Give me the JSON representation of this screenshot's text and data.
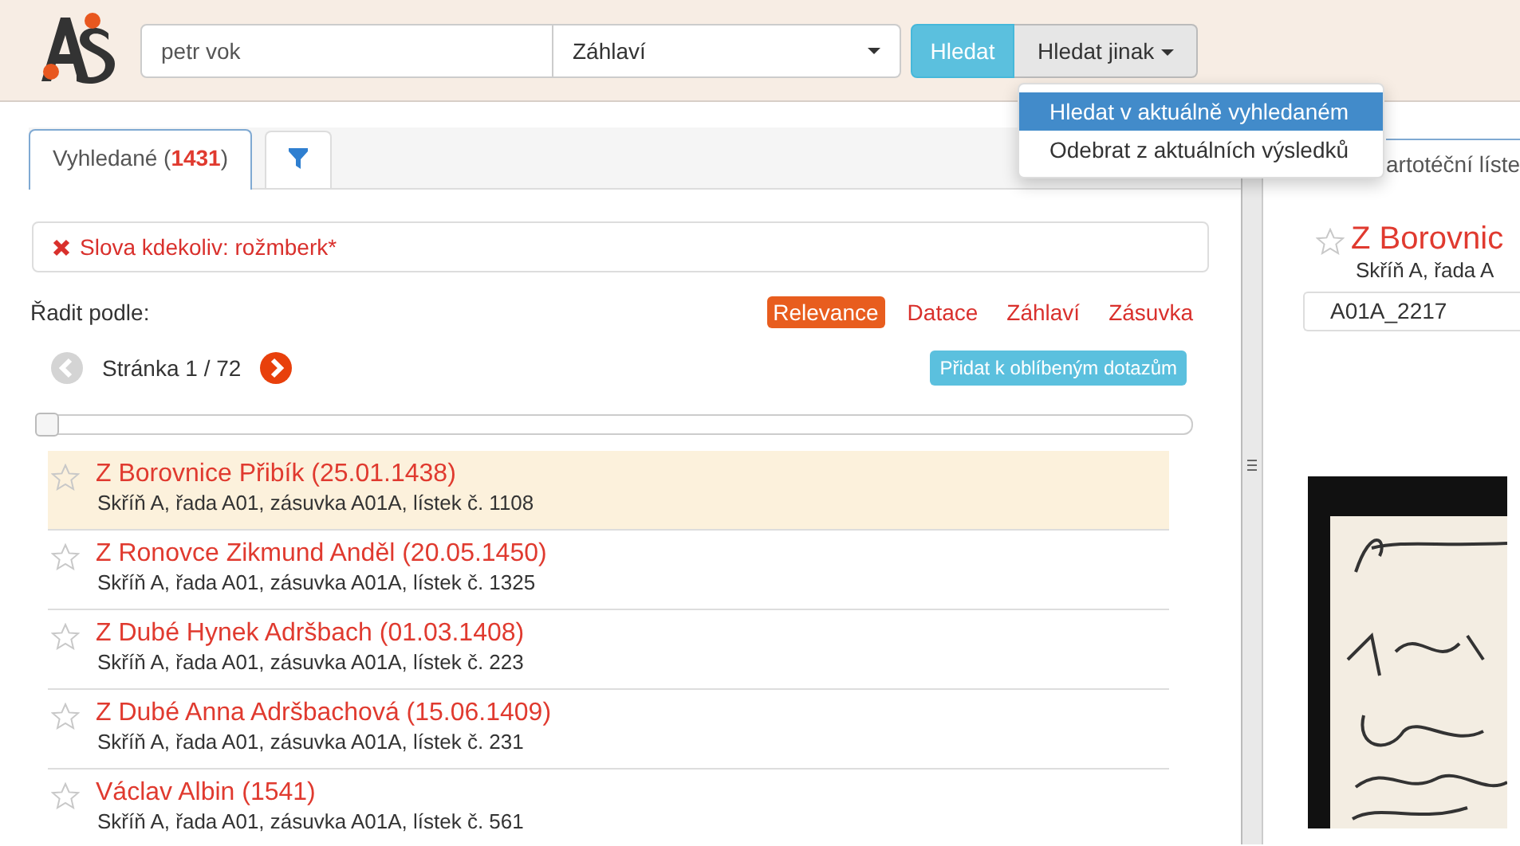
{
  "header": {
    "search": {
      "value": "petr vok"
    },
    "field_select": {
      "value": "Záhlaví"
    },
    "search_button": "Hledat",
    "more_button": "Hledat jinak",
    "menu": [
      {
        "label": "Hledat v aktuálně vyhledaném",
        "selected": true
      },
      {
        "label": "Odebrat z aktuálních výsledků",
        "selected": false
      }
    ]
  },
  "left": {
    "tabs": [
      {
        "kind": "text",
        "label": "Vyhledané (**1431**)",
        "selected": true
      },
      {
        "kind": "filter",
        "selected": false
      }
    ],
    "filter_chip": "Slova kdekoliv: rožmberk*",
    "sort_label": "Řadit podle:",
    "sort_options": [
      {
        "label": "Relevance",
        "selected": true
      },
      {
        "label": "Datace",
        "selected": false
      },
      {
        "label": "Záhlaví",
        "selected": false
      },
      {
        "label": "Zásuvka",
        "selected": false
      }
    ],
    "page": "Stránka 1 / 72",
    "favorite_button": "Přidat k oblíbeným dotazům",
    "slider": {
      "level": 0
    },
    "results": [
      {
        "title": "Z Borovnice Přibík (25.01.1438)",
        "location": "Skříň A, řada A01, zásuvka A01A, lístek č. 1108",
        "selected": true
      },
      {
        "title": "Z Ronovce Zikmund Anděl (20.05.1450)",
        "location": "Skříň A, řada A01, zásuvka A01A, lístek č. 1325",
        "selected": false
      },
      {
        "title": "Z Dubé Hynek Adršbach (01.03.1408)",
        "location": "Skříň A, řada A01, zásuvka A01A, lístek č. 223",
        "selected": false
      },
      {
        "title": "Z Dubé Anna Adršbachová (15.06.1409)",
        "location": "Skříň A, řada A01, zásuvka A01A, lístek č. 231",
        "selected": false
      },
      {
        "title": "Václav Albin (1541)",
        "location": "Skříň A, řada A01, zásuvka A01A, lístek č. 561",
        "selected": false
      }
    ]
  },
  "right": {
    "tab": "artotéční líste",
    "title": "Z Borovnic",
    "location": "Skříň A, řada A",
    "card_id": "A01A_2217"
  }
}
